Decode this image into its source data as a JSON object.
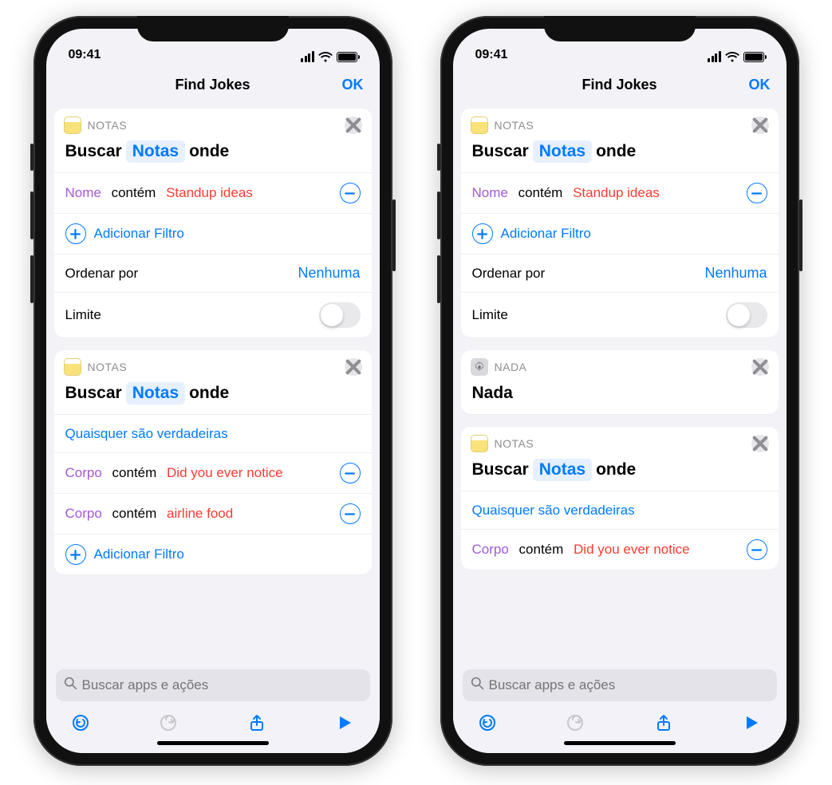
{
  "status": {
    "time": "09:41"
  },
  "nav": {
    "title": "Find Jokes",
    "ok": "OK"
  },
  "labels": {
    "notas_app": "NOTAS",
    "nada_app": "NADA",
    "buscar": "Buscar",
    "token_notas": "Notas",
    "onde": "onde",
    "nada_title": "Nada",
    "nome": "Nome",
    "corpo": "Corpo",
    "contem": "contém",
    "standup": "Standup ideas",
    "didyou": "Did you ever notice",
    "airline": "airline food",
    "any_true": "Quaisquer são verdadeiras",
    "add_filter": "Adicionar Filtro",
    "ordenar": "Ordenar por",
    "nenhuma": "Nenhuma",
    "limite": "Limite",
    "search_ph": "Buscar apps e ações"
  }
}
